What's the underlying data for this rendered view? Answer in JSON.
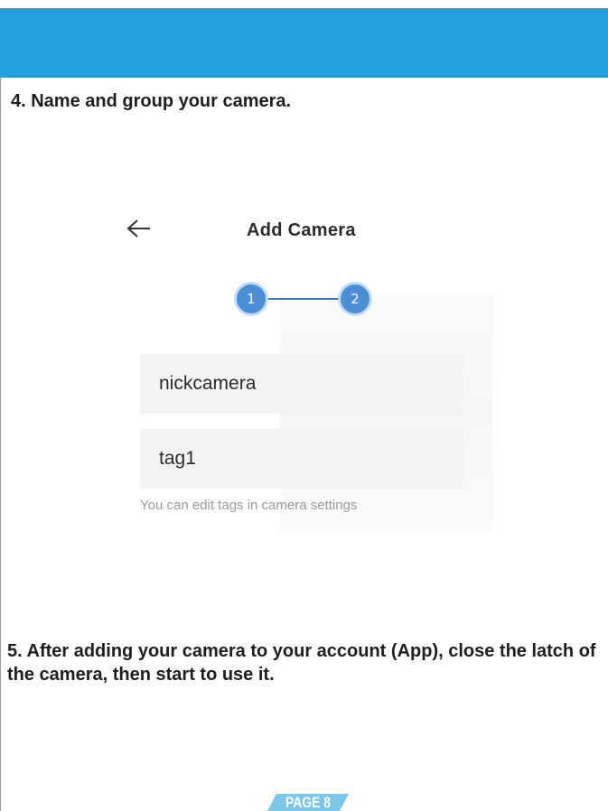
{
  "header": {
    "band_color": "#21a2dc"
  },
  "steps": {
    "step4_text": "4. Name and group your camera.",
    "step5_text": "5. After adding your camera to your account (App), close the latch of the camera, then start to use it."
  },
  "app_screen": {
    "back_icon": "arrow-left-icon",
    "title": "Add Camera",
    "stepper": {
      "step1_label": "1",
      "step2_label": "2",
      "active_color": "#4a8fd6"
    },
    "camera_name_value": "nickcamera",
    "tag_value": "tag1",
    "hint_text": "You can edit tags in camera settings"
  },
  "footer": {
    "page_label": "PAGE 8",
    "badge_color": "#7cc6ea"
  }
}
